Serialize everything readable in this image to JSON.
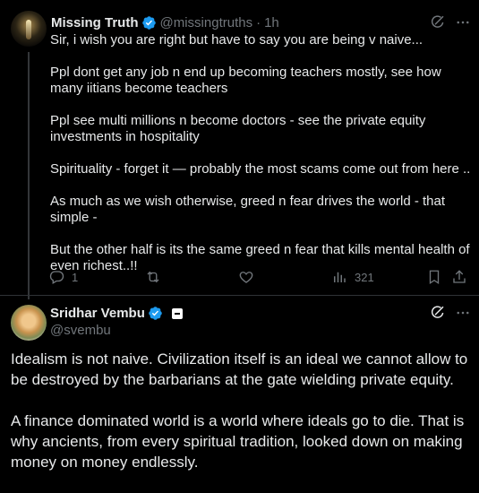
{
  "reply": {
    "name": "Missing Truth",
    "handle": "@missingtruths",
    "separator": "·",
    "time": "1h",
    "paragraphs": [
      "Sir, i wish you are right but have to say you are being v naive...",
      "Ppl dont get any job n end up becoming teachers mostly, see how many iitians become teachers",
      "Ppl see multi millions n become doctors - see the private equity investments in hospitality",
      "Spirituality - forget it — probably the most scams come out from here ..",
      "As much as we wish otherwise, greed n fear drives the world - that simple -",
      "But the other half is its the same greed n fear that kills mental health of even richest..!!"
    ],
    "actions": {
      "replies": "1",
      "reposts": "",
      "likes": "",
      "views": "321"
    }
  },
  "main": {
    "name": "Sridhar Vembu",
    "handle": "@svembu",
    "paragraphs": [
      "Idealism is not naive.  Civilization itself is an ideal we cannot allow to be destroyed by the barbarians at the gate wielding private equity.",
      "A finance dominated world is a world where ideals go to die. That is why ancients, from every spiritual tradition, looked down on making money on money endlessly."
    ]
  },
  "colors": {
    "background": "#000000",
    "text": "#e7e9ea",
    "muted": "#71767b",
    "verified": "#1d9bf0",
    "divider": "#2f3336"
  },
  "icons": {
    "verified": "verified-badge-icon",
    "grok": "grok-icon",
    "more": "more-icon",
    "reply": "reply-icon",
    "repost": "repost-icon",
    "like": "like-icon",
    "views": "views-icon",
    "bookmark": "bookmark-icon",
    "share": "share-icon"
  }
}
